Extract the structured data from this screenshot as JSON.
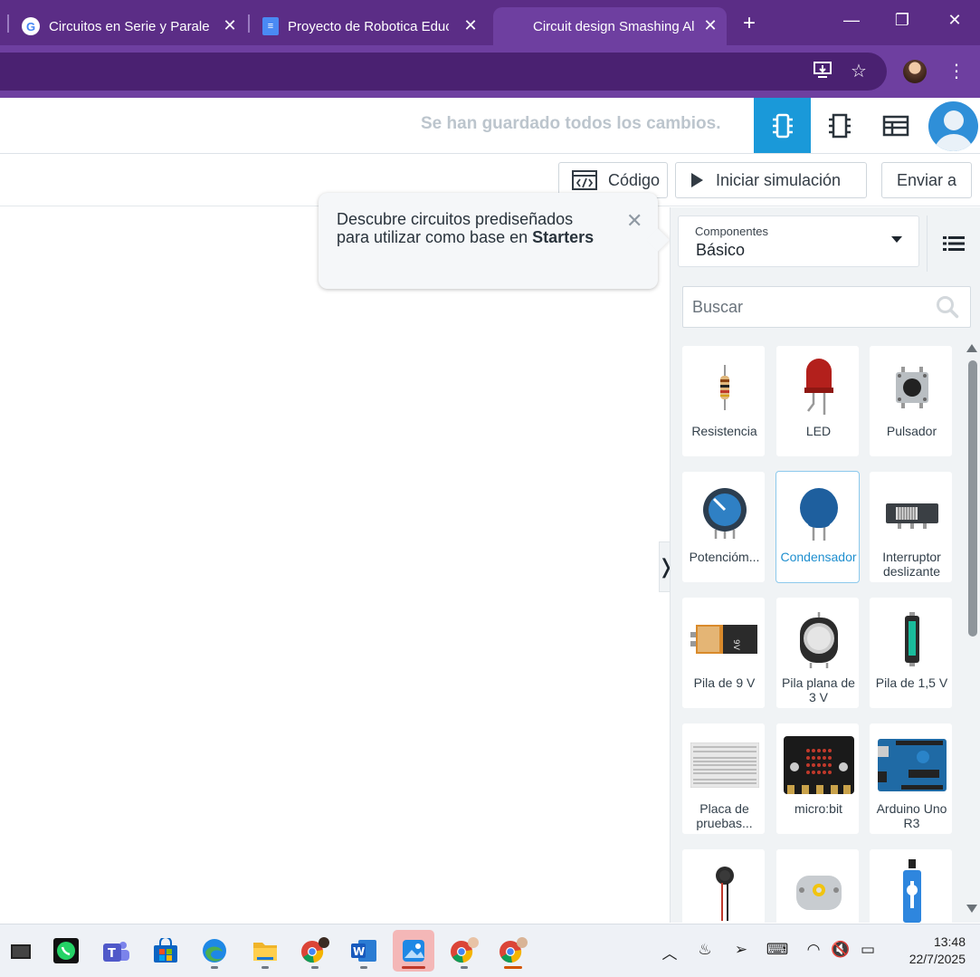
{
  "browser": {
    "tabs": [
      {
        "title": "Circuitos en Serie y Paralelo",
        "favicon": "google-icon"
      },
      {
        "title": "Proyecto de Robotica Educ",
        "favicon": "docs-icon"
      },
      {
        "title": "Circuit design Smashing Al",
        "favicon": "tinkercad-icon",
        "active": true
      }
    ],
    "new_tab": "+",
    "window": {
      "minimize": "—",
      "restore": "❐",
      "close": "✕"
    }
  },
  "app": {
    "save_status": "Se han guardado todos los cambios.",
    "toolbar": {
      "code": "Código",
      "start_sim": "Iniciar simulación",
      "send_to": "Enviar a"
    },
    "tooltip": {
      "text": "Descubre circuitos prediseñados para utilizar como base en ",
      "bold": "Starters",
      "close": "✕"
    },
    "panel": {
      "components_label": "Componentes",
      "components_value": "Básico",
      "search_placeholder": "Buscar",
      "collapse": "❭",
      "items": [
        {
          "name": "Resistencia"
        },
        {
          "name": "LED"
        },
        {
          "name": "Pulsador"
        },
        {
          "name": "Potencióm..."
        },
        {
          "name": "Condensador",
          "selected": true
        },
        {
          "name": "Interruptor deslizante"
        },
        {
          "name": "Pila de 9 V"
        },
        {
          "name": "Pila plana de 3 V"
        },
        {
          "name": "Pila de 1,5 V"
        },
        {
          "name": "Placa de pruebas..."
        },
        {
          "name": "micro:bit"
        },
        {
          "name": "Arduino Uno R3"
        },
        {
          "name": ""
        },
        {
          "name": ""
        },
        {
          "name": ""
        }
      ]
    }
  },
  "taskbar": {
    "apps": [
      "app-icon",
      "whatsapp-icon",
      "teams-icon",
      "store-icon",
      "edge-icon",
      "file-explorer-icon",
      "chrome-icon",
      "word-icon",
      "photos-icon",
      "chrome-profile-icon",
      "chrome-profile-icon"
    ],
    "clock_time": "13:48",
    "clock_date": "22/7/2025"
  },
  "colors": {
    "tabbar": "#5b2d86",
    "addrbar": "#6e3fa0",
    "accent": "#1a99d9"
  }
}
